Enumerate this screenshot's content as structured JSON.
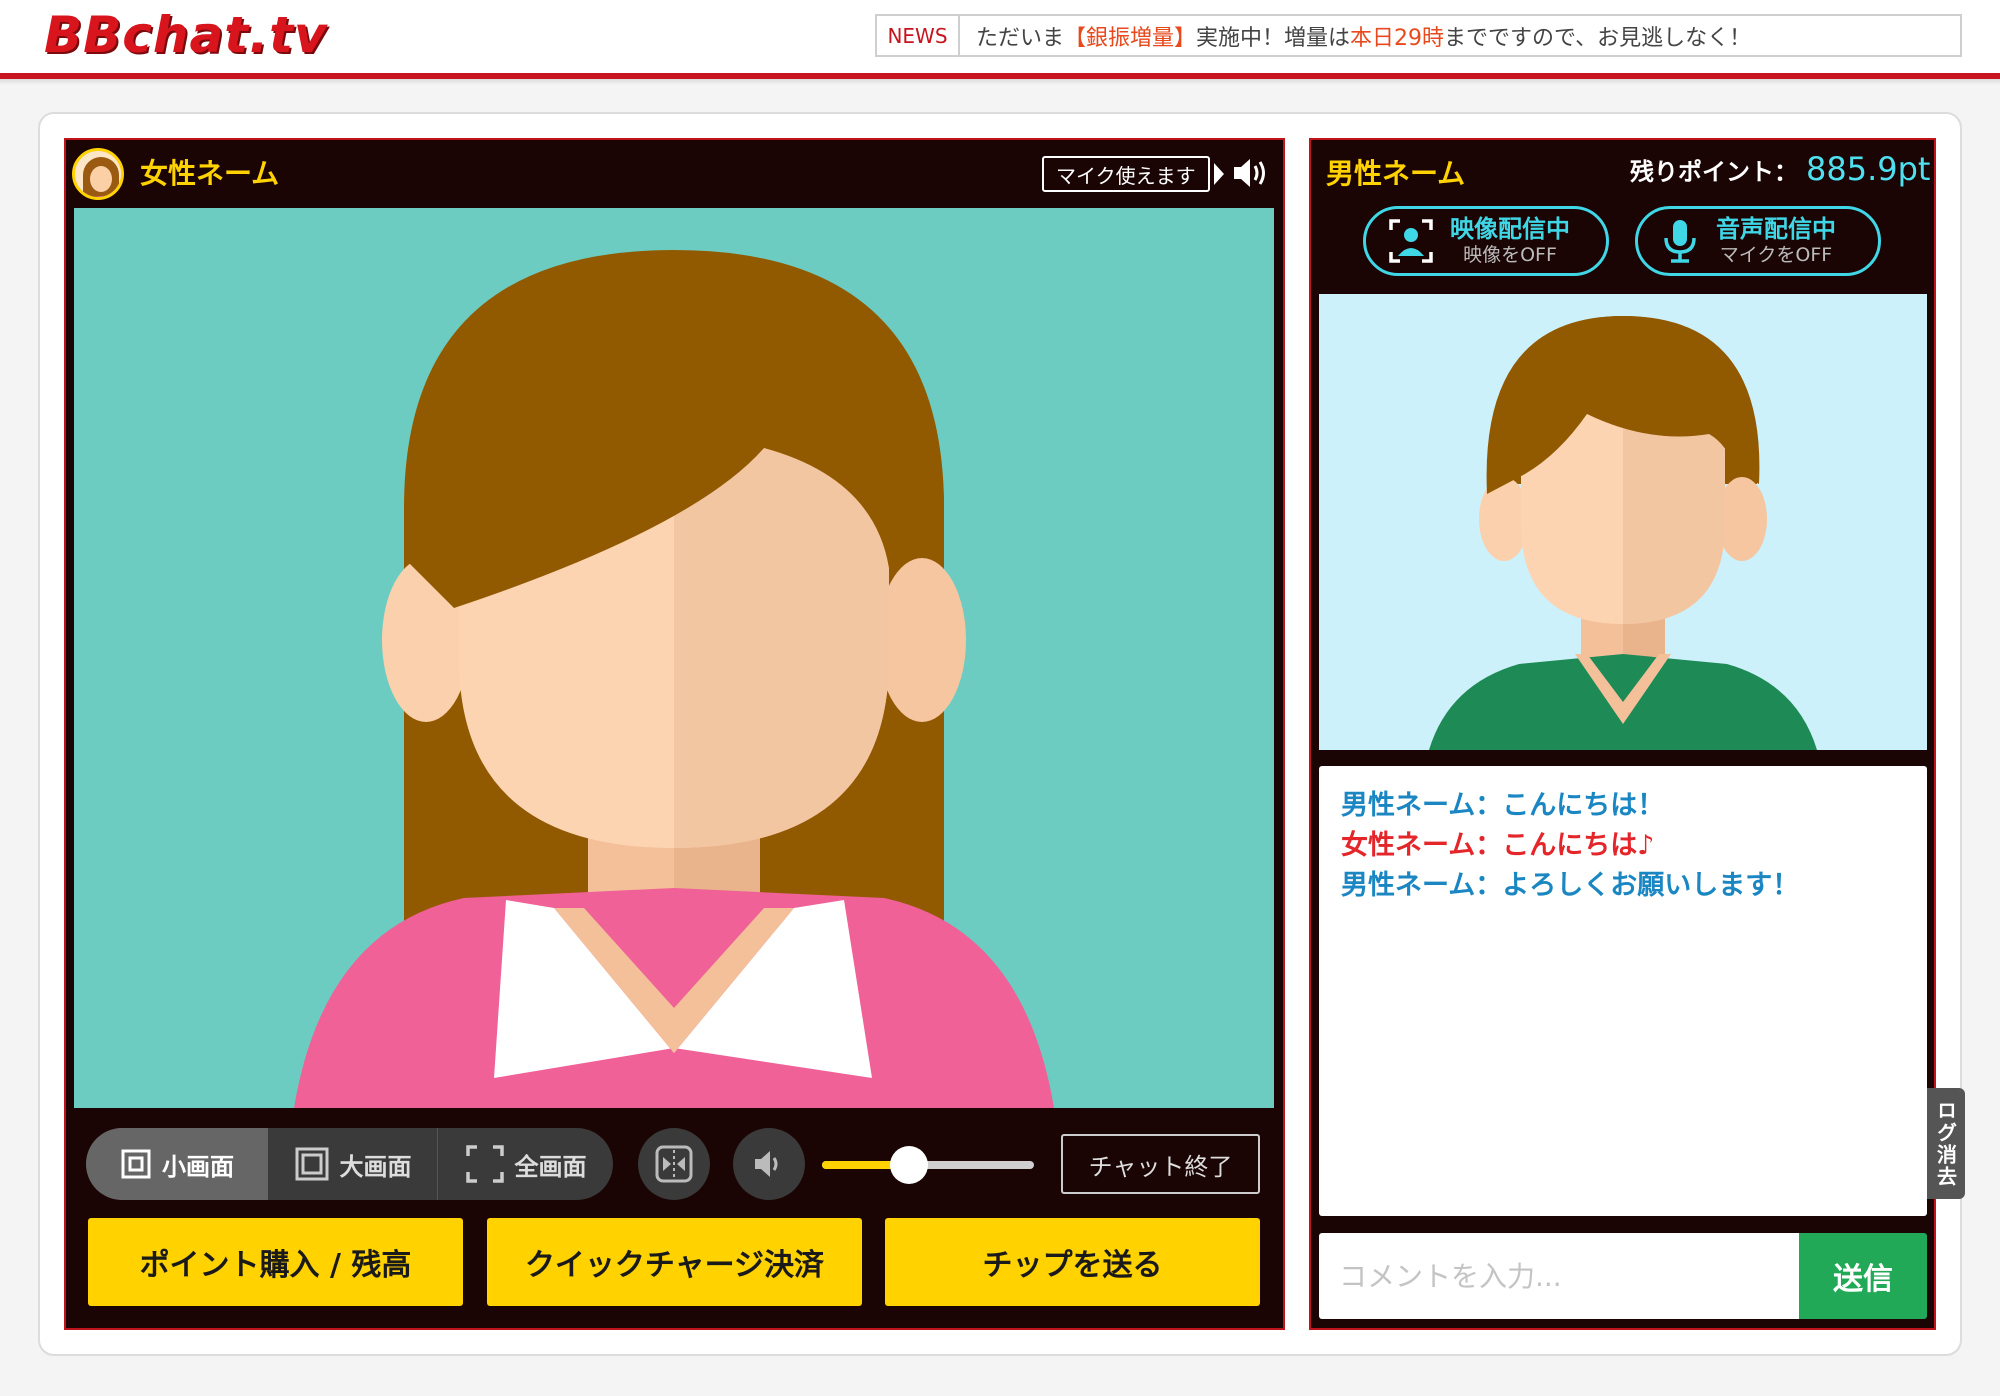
{
  "header": {
    "logo": "BBchat.tv",
    "news_label": "NEWS",
    "news_parts": [
      "ただいま",
      "【銀振増量】",
      "実施中！増量は",
      "本日29時",
      "までですので、お見逃しなく！"
    ]
  },
  "performer": {
    "name": "女性ネーム",
    "mic_badge": "マイク使えます"
  },
  "controls": {
    "view_small": "小画面",
    "view_large": "大画面",
    "view_full": "全画面",
    "volume_level": 0.41,
    "end_chat": "チャット終了"
  },
  "actions": {
    "buy_points": "ポイント購入 / 残高",
    "quick_charge": "クイックチャージ決済",
    "send_tip": "チップを送る"
  },
  "viewer": {
    "name": "男性ネーム",
    "points_label": "残りポイント：",
    "points_value": "885.9pt",
    "video_status": "映像配信中",
    "video_action": "映像をOFF",
    "audio_status": "音声配信中",
    "audio_action": "マイクをOFF"
  },
  "chat": {
    "messages": [
      {
        "text": "男性ネーム：こんにちは！"
      },
      {
        "text": "女性ネーム：こんにちは♪"
      },
      {
        "text": "男性ネーム：よろしくお願いします！"
      }
    ],
    "log_clear": "ログ消去",
    "input_placeholder": "コメントを入力...",
    "send": "送信"
  },
  "colors": {
    "brand_red": "#c8141e",
    "accent_yellow": "#ffd200",
    "accent_cyan": "#3fd6e6",
    "send_green": "#21a957"
  }
}
